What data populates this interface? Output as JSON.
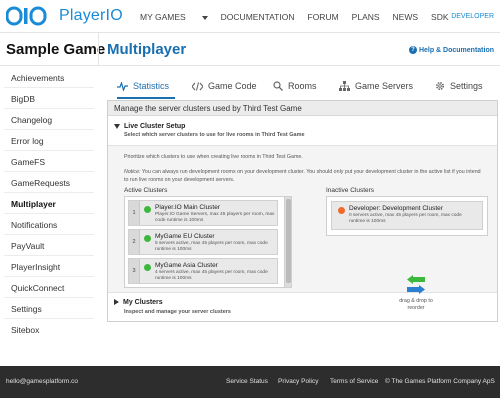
{
  "brand": {
    "name": "PlayerIO"
  },
  "topnav": {
    "items": [
      "MY GAMES",
      "DOCUMENTATION",
      "FORUM",
      "PLANS",
      "NEWS",
      "SDK"
    ],
    "developer": "DEVELOPER"
  },
  "header": {
    "game": "Sample Game",
    "page": "Multiplayer",
    "help": "Help & Documentation"
  },
  "sidebar": {
    "items": [
      {
        "label": "Achievements",
        "active": false
      },
      {
        "label": "BigDB",
        "active": false
      },
      {
        "label": "Changelog",
        "active": false
      },
      {
        "label": "Error log",
        "active": false
      },
      {
        "label": "GameFS",
        "active": false
      },
      {
        "label": "GameRequests",
        "active": false
      },
      {
        "label": "Multiplayer",
        "active": true
      },
      {
        "label": "Notifications",
        "active": false
      },
      {
        "label": "PayVault",
        "active": false
      },
      {
        "label": "PlayerInsight",
        "active": false
      },
      {
        "label": "QuickConnect",
        "active": false
      },
      {
        "label": "Settings",
        "active": false
      },
      {
        "label": "Sitebox",
        "active": false
      }
    ]
  },
  "tabs": [
    {
      "label": "Statistics",
      "icon": "pulse-icon",
      "active": true
    },
    {
      "label": "Game Code",
      "icon": "code-icon",
      "active": false
    },
    {
      "label": "Rooms",
      "icon": "search-icon",
      "active": false
    },
    {
      "label": "Game Servers",
      "icon": "network-icon",
      "active": false
    },
    {
      "label": "Settings",
      "icon": "gear-icon",
      "active": false
    }
  ],
  "panel": {
    "title": "Manage the server clusters used by Third Test Game",
    "live": {
      "heading": "Live Cluster Setup",
      "sub": "Select which server clusters to use for live rooms in Third Test Game",
      "intro": "Prioritize which clusters to use when creating live rooms in Third Test Game.",
      "notice_label": "Notice:",
      "notice": "You can always run development rooms on your development cluster. You should only put your development cluster in the active list if you intend to run live rooms on your development servers.",
      "active_label": "Active Clusters",
      "inactive_label": "Inactive Clusters",
      "dragdrop": "drag & drop to reorder",
      "active": [
        {
          "num": "1",
          "name": "Player.IO Main Cluster",
          "desc": "Player.IO Game Servers, max 45 players per room, max code runtime is 100ms",
          "status": "green"
        },
        {
          "num": "2",
          "name": "MyGame EU Cluster",
          "desc": "5 servers active, max 45 players per room, max code runtime is 100ms",
          "status": "green"
        },
        {
          "num": "3",
          "name": "MyGame Asia Cluster",
          "desc": "4 servers active, max 45 players per room, max code runtime is 100ms",
          "status": "green"
        }
      ],
      "inactive": [
        {
          "name": "Developer: Development Cluster",
          "desc": "0 servers active, max 45 players per room, max code runtime is 100ms",
          "status": "orange"
        }
      ]
    },
    "my": {
      "heading": "My Clusters",
      "sub": "Inspect and manage your server clusters"
    }
  },
  "colors": {
    "accent": "#1a6fb0",
    "logo": "#1a8bd6",
    "status_green": "#3cb83c",
    "status_orange": "#ee6a2a",
    "footer_bg": "#2d2d2d"
  },
  "footer": {
    "email": "hello@gamesplatform.co",
    "links": [
      "Service Status",
      "Privacy Policy",
      "Terms of Service"
    ],
    "copyright": "© The Games Platform Company ApS"
  }
}
